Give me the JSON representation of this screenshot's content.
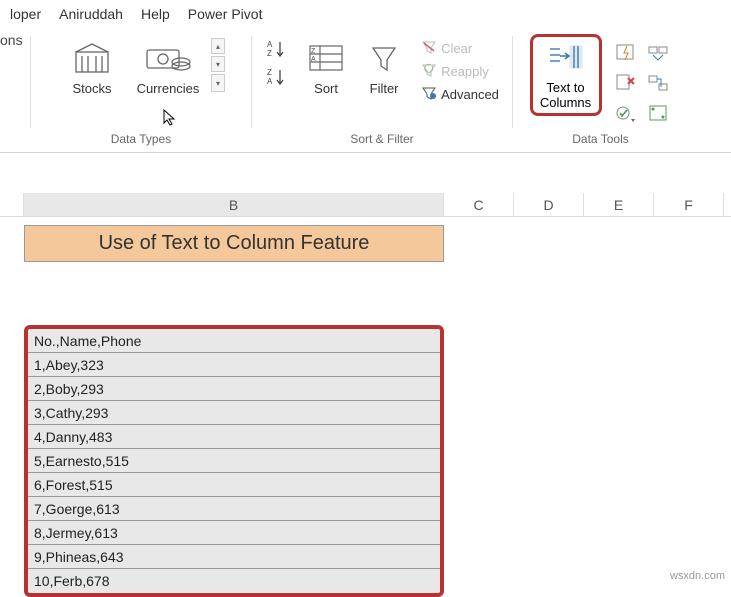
{
  "menu": {
    "items": [
      "loper",
      "Aniruddah",
      "Help",
      "Power Pivot"
    ]
  },
  "ribbon": {
    "ons_label": "ons",
    "dataTypes": {
      "stocks": "Stocks",
      "currencies": "Currencies",
      "group_label": "Data Types"
    },
    "sortFilter": {
      "sort": "Sort",
      "filter": "Filter",
      "clear": "Clear",
      "reapply": "Reapply",
      "advanced": "Advanced",
      "group_label": "Sort & Filter"
    },
    "dataTools": {
      "text_to_columns_l1": "Text to",
      "text_to_columns_l2": "Columns",
      "group_label": "Data Tools"
    }
  },
  "columns": [
    "B",
    "C",
    "D",
    "E",
    "F"
  ],
  "title_cell": "Use of Text to Column Feature",
  "data_rows": [
    "No.,Name,Phone",
    "1,Abey,323",
    "2,Boby,293",
    "3,Cathy,293",
    "4,Danny,483",
    "5,Earnesto,515",
    "6,Forest,515",
    "7,Goerge,613",
    "8,Jermey,613",
    "9,Phineas,643",
    "10,Ferb,678"
  ],
  "watermark": "wsxdn.com"
}
